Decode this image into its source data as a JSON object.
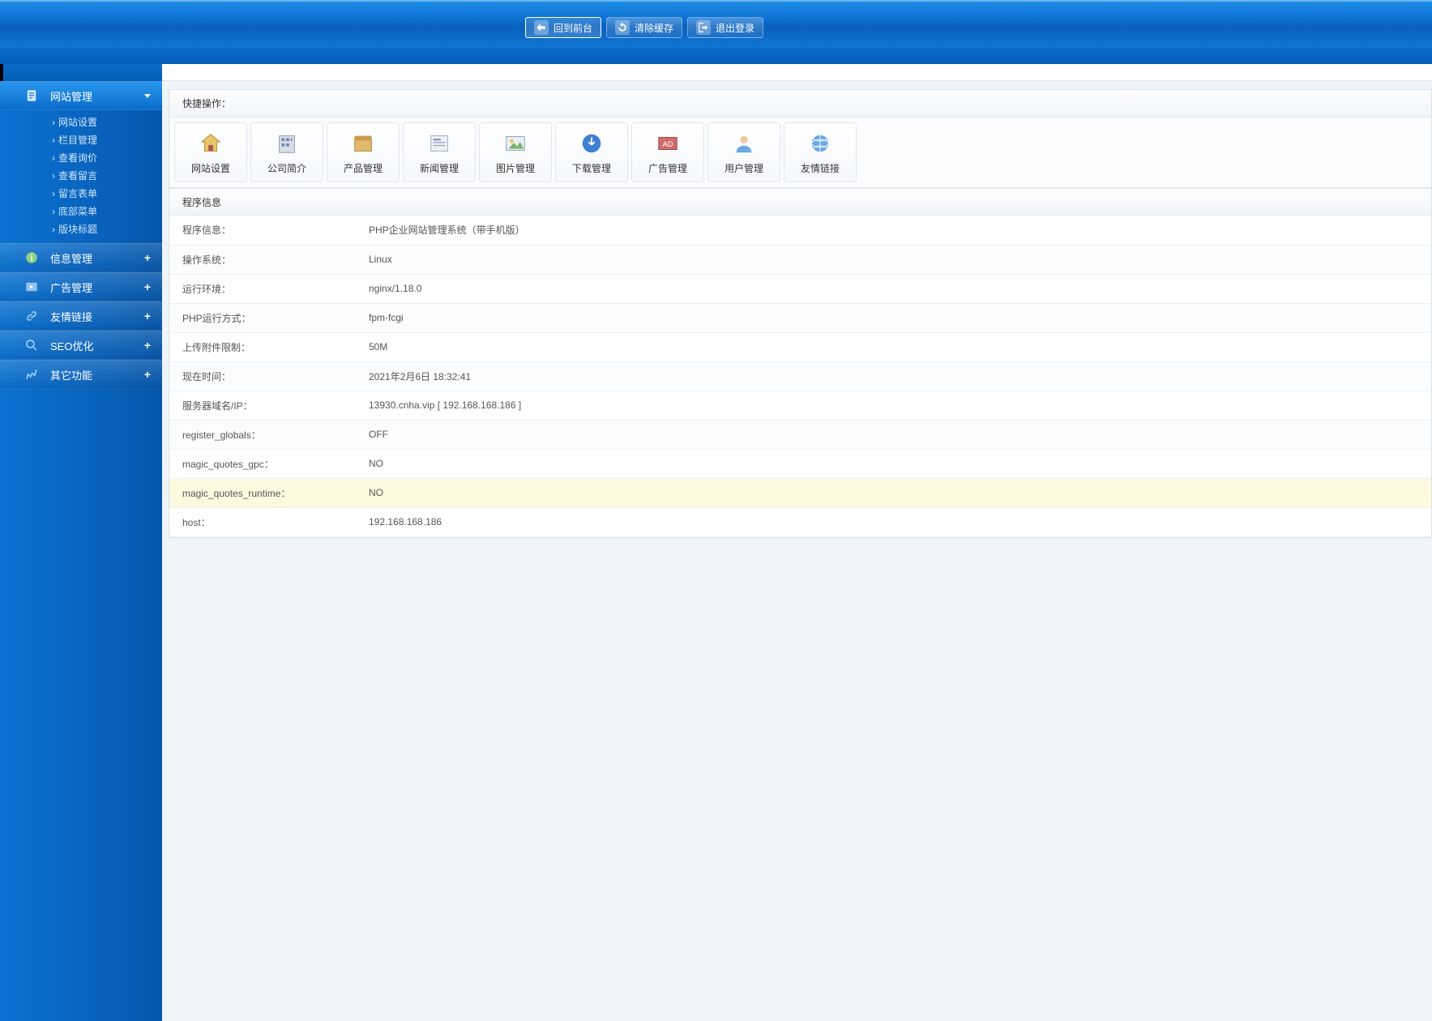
{
  "top": {
    "back_front": "回到前台",
    "clear_cache": "清除缓存",
    "logout": "退出登录"
  },
  "sidebar": {
    "groups": [
      {
        "label": "网站管理",
        "open": true,
        "icon": "doc",
        "items": [
          "网站设置",
          "栏目管理",
          "查看询价",
          "查看留言",
          "留言表单",
          "底部菜单",
          "版块标题"
        ]
      },
      {
        "label": "信息管理",
        "open": false,
        "icon": "info"
      },
      {
        "label": "广告管理",
        "open": false,
        "icon": "ad"
      },
      {
        "label": "友情链接",
        "open": false,
        "icon": "link"
      },
      {
        "label": "SEO优化",
        "open": false,
        "icon": "seo"
      },
      {
        "label": "其它功能",
        "open": false,
        "icon": "other"
      }
    ]
  },
  "content": {
    "quick_title": "快捷操作：",
    "quick": [
      {
        "label": "网站设置",
        "icon": "home"
      },
      {
        "label": "公司简介",
        "icon": "company"
      },
      {
        "label": "产品管理",
        "icon": "product"
      },
      {
        "label": "新闻管理",
        "icon": "news"
      },
      {
        "label": "图片管理",
        "icon": "image"
      },
      {
        "label": "下载管理",
        "icon": "download"
      },
      {
        "label": "广告管理",
        "icon": "adm"
      },
      {
        "label": "用户管理",
        "icon": "user"
      },
      {
        "label": "友情链接",
        "icon": "flink"
      }
    ],
    "info_title": "程序信息",
    "rows": [
      {
        "k": "程序信息：",
        "v": "PHP企业网站管理系统（带手机版）"
      },
      {
        "k": "操作系统：",
        "v": "Linux"
      },
      {
        "k": "运行环境：",
        "v": "nginx/1.18.0"
      },
      {
        "k": "PHP运行方式：",
        "v": "fpm-fcgi"
      },
      {
        "k": "上传附件限制：",
        "v": "50M"
      },
      {
        "k": "现在时间：",
        "v": "2021年2月6日 18:32:41"
      },
      {
        "k": "服务器域名/IP：",
        "v": "13930.cnha.vip [ 192.168.168.186 ]"
      },
      {
        "k": "register_globals：",
        "v": "OFF"
      },
      {
        "k": "magic_quotes_gpc：",
        "v": "NO"
      },
      {
        "k": "magic_quotes_runtime：",
        "v": "NO",
        "hl": true
      },
      {
        "k": "host：",
        "v": "192.168.168.186"
      }
    ]
  }
}
